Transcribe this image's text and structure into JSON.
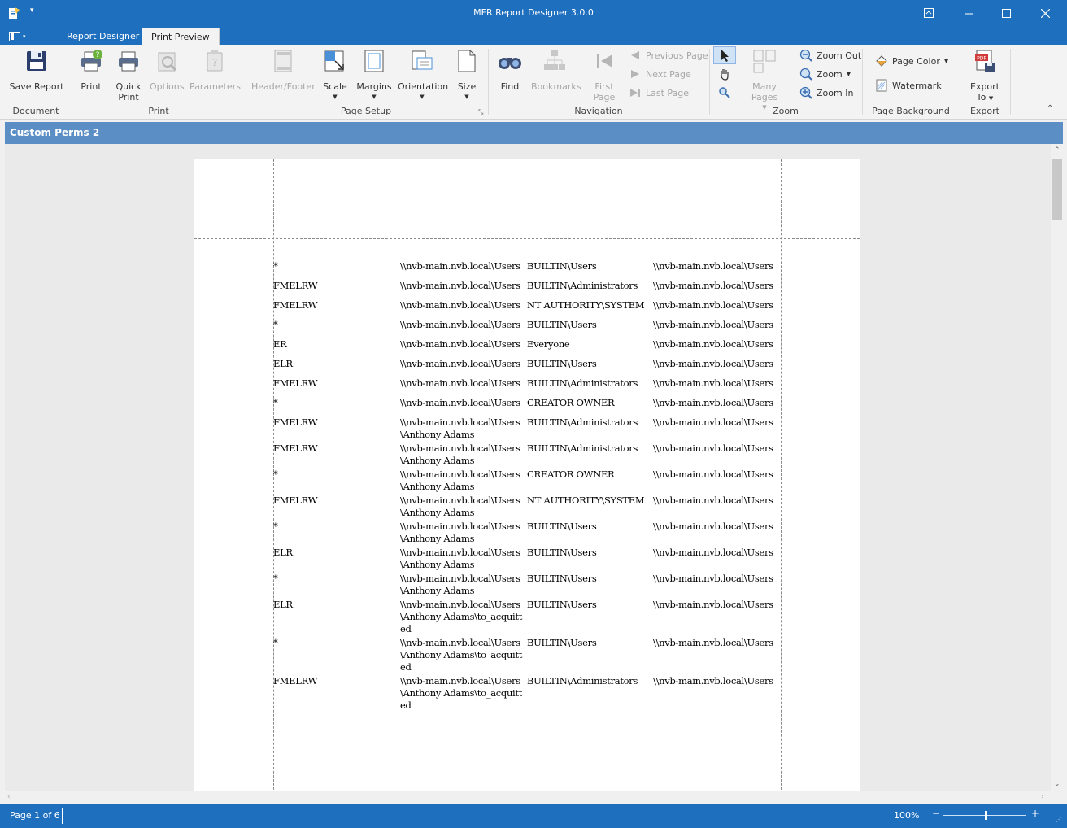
{
  "window": {
    "title": "MFR Report Designer 3.0.0"
  },
  "tabs": [
    {
      "label": "Report Designer"
    },
    {
      "label": "Print Preview"
    }
  ],
  "ribbon": {
    "groups": {
      "document": "Document",
      "print": "Print",
      "page_setup": "Page Setup",
      "navigation": "Navigation",
      "zoom": "Zoom",
      "page_background": "Page Background",
      "export": "Export"
    },
    "buttons": {
      "save_report": "Save Report",
      "print": "Print",
      "quick_print_1": "Quick",
      "quick_print_2": "Print",
      "options": "Options",
      "parameters": "Parameters",
      "header_footer": "Header/Footer",
      "scale": "Scale",
      "margins": "Margins",
      "orientation": "Orientation",
      "size": "Size",
      "find": "Find",
      "bookmarks": "Bookmarks",
      "first_page_1": "First",
      "first_page_2": "Page",
      "previous_page": "Previous Page",
      "next_page": "Next Page",
      "last_page": "Last Page",
      "many_pages": "Many Pages",
      "zoom_out": "Zoom Out",
      "zoom": "Zoom",
      "zoom_in": "Zoom In",
      "page_color": "Page Color",
      "watermark": "Watermark",
      "export_to_1": "Export",
      "export_to_2": "To"
    }
  },
  "document": {
    "title": "Custom Perms 2"
  },
  "report_rows": [
    {
      "perm": "*",
      "path": "\\\\nvb-main.nvb.local\\Users",
      "account": "BUILTIN\\Users",
      "share": "\\\\nvb-main.nvb.local\\Users"
    },
    {
      "perm": "FMELRW",
      "path": "\\\\nvb-main.nvb.local\\Users",
      "account": "BUILTIN\\Administrators",
      "share": "\\\\nvb-main.nvb.local\\Users"
    },
    {
      "perm": "FMELRW",
      "path": "\\\\nvb-main.nvb.local\\Users",
      "account": "NT AUTHORITY\\SYSTEM",
      "share": "\\\\nvb-main.nvb.local\\Users"
    },
    {
      "perm": "*",
      "path": "\\\\nvb-main.nvb.local\\Users",
      "account": "BUILTIN\\Users",
      "share": "\\\\nvb-main.nvb.local\\Users"
    },
    {
      "perm": "ER",
      "path": "\\\\nvb-main.nvb.local\\Users",
      "account": "Everyone",
      "share": "\\\\nvb-main.nvb.local\\Users"
    },
    {
      "perm": "ELR",
      "path": "\\\\nvb-main.nvb.local\\Users",
      "account": "BUILTIN\\Users",
      "share": "\\\\nvb-main.nvb.local\\Users"
    },
    {
      "perm": "FMELRW",
      "path": "\\\\nvb-main.nvb.local\\Users",
      "account": "BUILTIN\\Administrators",
      "share": "\\\\nvb-main.nvb.local\\Users"
    },
    {
      "perm": "*",
      "path": "\\\\nvb-main.nvb.local\\Users",
      "account": "CREATOR OWNER",
      "share": "\\\\nvb-main.nvb.local\\Users"
    },
    {
      "perm": "FMELRW",
      "path": "\\\\nvb-main.nvb.local\\Users\\Anthony Adams",
      "account": "BUILTIN\\Administrators",
      "share": "\\\\nvb-main.nvb.local\\Users"
    },
    {
      "perm": "FMELRW",
      "path": "\\\\nvb-main.nvb.local\\Users\\Anthony Adams",
      "account": "BUILTIN\\Administrators",
      "share": "\\\\nvb-main.nvb.local\\Users"
    },
    {
      "perm": "*",
      "path": "\\\\nvb-main.nvb.local\\Users\\Anthony Adams",
      "account": "CREATOR OWNER",
      "share": "\\\\nvb-main.nvb.local\\Users"
    },
    {
      "perm": "FMELRW",
      "path": "\\\\nvb-main.nvb.local\\Users\\Anthony Adams",
      "account": "NT AUTHORITY\\SYSTEM",
      "share": "\\\\nvb-main.nvb.local\\Users"
    },
    {
      "perm": "*",
      "path": "\\\\nvb-main.nvb.local\\Users\\Anthony Adams",
      "account": "BUILTIN\\Users",
      "share": "\\\\nvb-main.nvb.local\\Users"
    },
    {
      "perm": "ELR",
      "path": "\\\\nvb-main.nvb.local\\Users\\Anthony Adams",
      "account": "BUILTIN\\Users",
      "share": "\\\\nvb-main.nvb.local\\Users"
    },
    {
      "perm": "*",
      "path": "\\\\nvb-main.nvb.local\\Users\\Anthony Adams",
      "account": "BUILTIN\\Users",
      "share": "\\\\nvb-main.nvb.local\\Users"
    },
    {
      "perm": "ELR",
      "path": "\\\\nvb-main.nvb.local\\Users\\Anthony Adams\\to_acquitted",
      "account": "BUILTIN\\Users",
      "share": "\\\\nvb-main.nvb.local\\Users"
    },
    {
      "perm": "*",
      "path": "\\\\nvb-main.nvb.local\\Users\\Anthony Adams\\to_acquitted",
      "account": "BUILTIN\\Users",
      "share": "\\\\nvb-main.nvb.local\\Users"
    },
    {
      "perm": "FMELRW",
      "path": "\\\\nvb-main.nvb.local\\Users\\Anthony Adams\\to_acquitted",
      "account": "BUILTIN\\Administrators",
      "share": "\\\\nvb-main.nvb.local\\Users"
    }
  ],
  "status": {
    "page_info": "Page 1 of 6",
    "zoom_level": "100%",
    "zoom_fraction": 0.5
  },
  "colors": {
    "accent": "#1f6fbf",
    "doc_header": "#5b8ec4"
  }
}
